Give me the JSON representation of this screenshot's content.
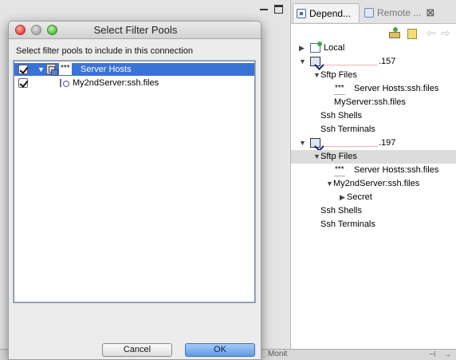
{
  "workbench": {
    "tabs": [
      {
        "label": "Depend..."
      },
      {
        "label": "Remote ...",
        "close": "⊠"
      }
    ],
    "tree": [
      {
        "label": "Local",
        "twisty": "▶"
      },
      {
        "label": ".157",
        "twisty": "▼"
      },
      {
        "label": "Sftp Files",
        "twisty": "▼"
      },
      {
        "stars": "***",
        "label": "Server Hosts:ssh.files"
      },
      {
        "label": "MyServer:ssh.files"
      },
      {
        "label": "Ssh Shells"
      },
      {
        "label": "Ssh Terminals"
      },
      {
        "label": ".197",
        "twisty": "▼"
      },
      {
        "label": "Sftp Files",
        "twisty": "▼"
      },
      {
        "stars": "***",
        "label": "Server Hosts:ssh.files"
      },
      {
        "label": "My2ndServer:ssh.files",
        "twisty": "▼"
      },
      {
        "label": "Secret",
        "twisty": "▶"
      },
      {
        "label": "Ssh Shells"
      },
      {
        "label": "Ssh Terminals"
      }
    ],
    "bottom_text": "Monit"
  },
  "dialog": {
    "title": "Select Filter Pools",
    "instruction": "Select filter pools to include in this connection",
    "pools": [
      {
        "twisty": "▼",
        "stars": "***",
        "label": "Server Hosts",
        "checked": true
      },
      {
        "label": "My2ndServer:ssh.files",
        "checked": true
      }
    ],
    "cancel_label": "Cancel",
    "ok_label": "OK"
  },
  "colors": {
    "selection": "#3a73d6",
    "ok_button": "#5f9be6"
  }
}
